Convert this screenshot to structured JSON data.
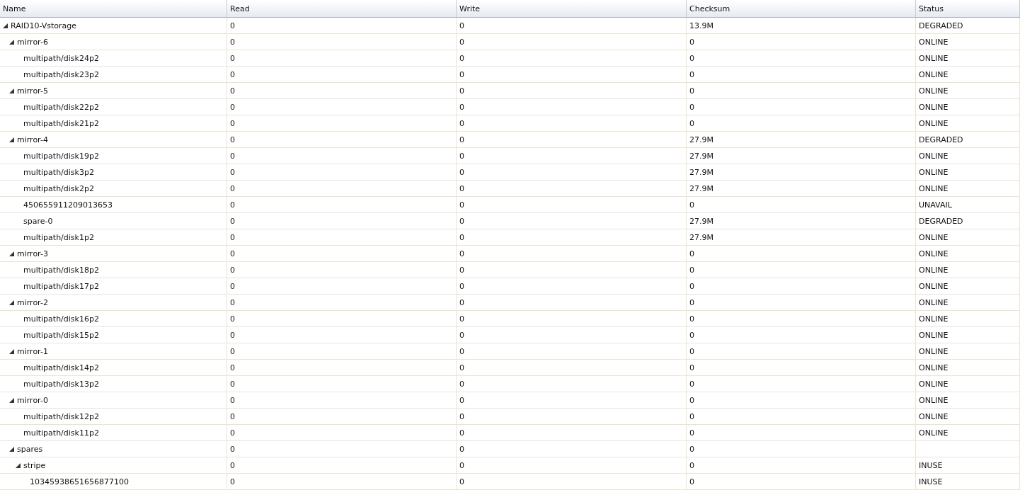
{
  "table": {
    "columns": [
      "Name",
      "Read",
      "Write",
      "Checksum",
      "Status"
    ],
    "rows": [
      {
        "name": "RAID10-Vstorage",
        "read": "0",
        "write": "0",
        "checksum": "13.9M",
        "status": "DEGRADED",
        "expanded": true,
        "children": [
          {
            "name": "mirror-6",
            "read": "0",
            "write": "0",
            "checksum": "0",
            "status": "ONLINE",
            "expanded": true,
            "children": [
              {
                "name": "multipath/disk24p2",
                "read": "0",
                "write": "0",
                "checksum": "0",
                "status": "ONLINE"
              },
              {
                "name": "multipath/disk23p2",
                "read": "0",
                "write": "0",
                "checksum": "0",
                "status": "ONLINE"
              }
            ]
          },
          {
            "name": "mirror-5",
            "read": "0",
            "write": "0",
            "checksum": "0",
            "status": "ONLINE",
            "expanded": true,
            "children": [
              {
                "name": "multipath/disk22p2",
                "read": "0",
                "write": "0",
                "checksum": "0",
                "status": "ONLINE"
              },
              {
                "name": "multipath/disk21p2",
                "read": "0",
                "write": "0",
                "checksum": "0",
                "status": "ONLINE"
              }
            ]
          },
          {
            "name": "mirror-4",
            "read": "0",
            "write": "0",
            "checksum": "27.9M",
            "status": "DEGRADED",
            "expanded": true,
            "children": [
              {
                "name": "multipath/disk19p2",
                "read": "0",
                "write": "0",
                "checksum": "27.9M",
                "status": "ONLINE"
              },
              {
                "name": "multipath/disk3p2",
                "read": "0",
                "write": "0",
                "checksum": "27.9M",
                "status": "ONLINE"
              },
              {
                "name": "multipath/disk2p2",
                "read": "0",
                "write": "0",
                "checksum": "27.9M",
                "status": "ONLINE"
              },
              {
                "name": "450655911209013653",
                "read": "0",
                "write": "0",
                "checksum": "0",
                "status": "UNAVAIL"
              },
              {
                "name": "spare-0",
                "read": "0",
                "write": "0",
                "checksum": "27.9M",
                "status": "DEGRADED"
              },
              {
                "name": "multipath/disk1p2",
                "read": "0",
                "write": "0",
                "checksum": "27.9M",
                "status": "ONLINE"
              }
            ]
          },
          {
            "name": "mirror-3",
            "read": "0",
            "write": "0",
            "checksum": "0",
            "status": "ONLINE",
            "expanded": true,
            "children": [
              {
                "name": "multipath/disk18p2",
                "read": "0",
                "write": "0",
                "checksum": "0",
                "status": "ONLINE"
              },
              {
                "name": "multipath/disk17p2",
                "read": "0",
                "write": "0",
                "checksum": "0",
                "status": "ONLINE"
              }
            ]
          },
          {
            "name": "mirror-2",
            "read": "0",
            "write": "0",
            "checksum": "0",
            "status": "ONLINE",
            "expanded": true,
            "children": [
              {
                "name": "multipath/disk16p2",
                "read": "0",
                "write": "0",
                "checksum": "0",
                "status": "ONLINE"
              },
              {
                "name": "multipath/disk15p2",
                "read": "0",
                "write": "0",
                "checksum": "0",
                "status": "ONLINE"
              }
            ]
          },
          {
            "name": "mirror-1",
            "read": "0",
            "write": "0",
            "checksum": "0",
            "status": "ONLINE",
            "expanded": true,
            "children": [
              {
                "name": "multipath/disk14p2",
                "read": "0",
                "write": "0",
                "checksum": "0",
                "status": "ONLINE"
              },
              {
                "name": "multipath/disk13p2",
                "read": "0",
                "write": "0",
                "checksum": "0",
                "status": "ONLINE"
              }
            ]
          },
          {
            "name": "mirror-0",
            "read": "0",
            "write": "0",
            "checksum": "0",
            "status": "ONLINE",
            "expanded": true,
            "children": [
              {
                "name": "multipath/disk12p2",
                "read": "0",
                "write": "0",
                "checksum": "0",
                "status": "ONLINE"
              },
              {
                "name": "multipath/disk11p2",
                "read": "0",
                "write": "0",
                "checksum": "0",
                "status": "ONLINE"
              }
            ]
          },
          {
            "name": "spares",
            "read": "0",
            "write": "0",
            "checksum": "0",
            "expanded": true,
            "children": [
              {
                "name": "stripe",
                "read": "0",
                "write": "0",
                "checksum": "0",
                "status": "INUSE",
                "expanded": true,
                "children": [
                  {
                    "name": "10345938651656877100",
                    "read": "0",
                    "write": "0",
                    "checksum": "0",
                    "status": "INUSE"
                  }
                ]
              }
            ]
          }
        ]
      }
    ]
  }
}
